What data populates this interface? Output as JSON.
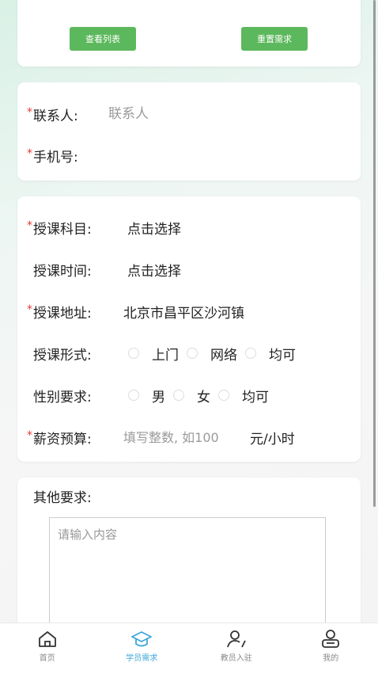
{
  "buttons": {
    "view_list": "查看列表",
    "reset": "重置需求"
  },
  "contact": {
    "name_label": "联系人:",
    "name_placeholder": "联系人",
    "phone_label": "手机号:"
  },
  "lesson": {
    "subject_label": "授课科目:",
    "subject_value": "点击选择",
    "time_label": "授课时间:",
    "time_value": "点击选择",
    "address_label": "授课地址:",
    "address_value": "北京市昌平区沙河镇",
    "form_label": "授课形式:",
    "form_options": [
      "上门",
      "网络",
      "均可"
    ],
    "gender_label": "性别要求:",
    "gender_options": [
      "男",
      "女",
      "均可"
    ],
    "salary_label": "薪资预算:",
    "salary_placeholder": "填写整数, 如100",
    "salary_unit": "元/小时"
  },
  "other": {
    "label": "其他要求:",
    "placeholder": "请输入内容"
  },
  "tabbar": {
    "items": [
      {
        "label": "首页",
        "icon": "home-icon"
      },
      {
        "label": "学员需求",
        "icon": "graduation-cap-icon"
      },
      {
        "label": "教员入驻",
        "icon": "teacher-icon"
      },
      {
        "label": "我的",
        "icon": "profile-icon"
      }
    ],
    "active_color": "#3da7d8"
  },
  "colors": {
    "accent_green": "#5cb85c",
    "required_red": "#e53935"
  }
}
